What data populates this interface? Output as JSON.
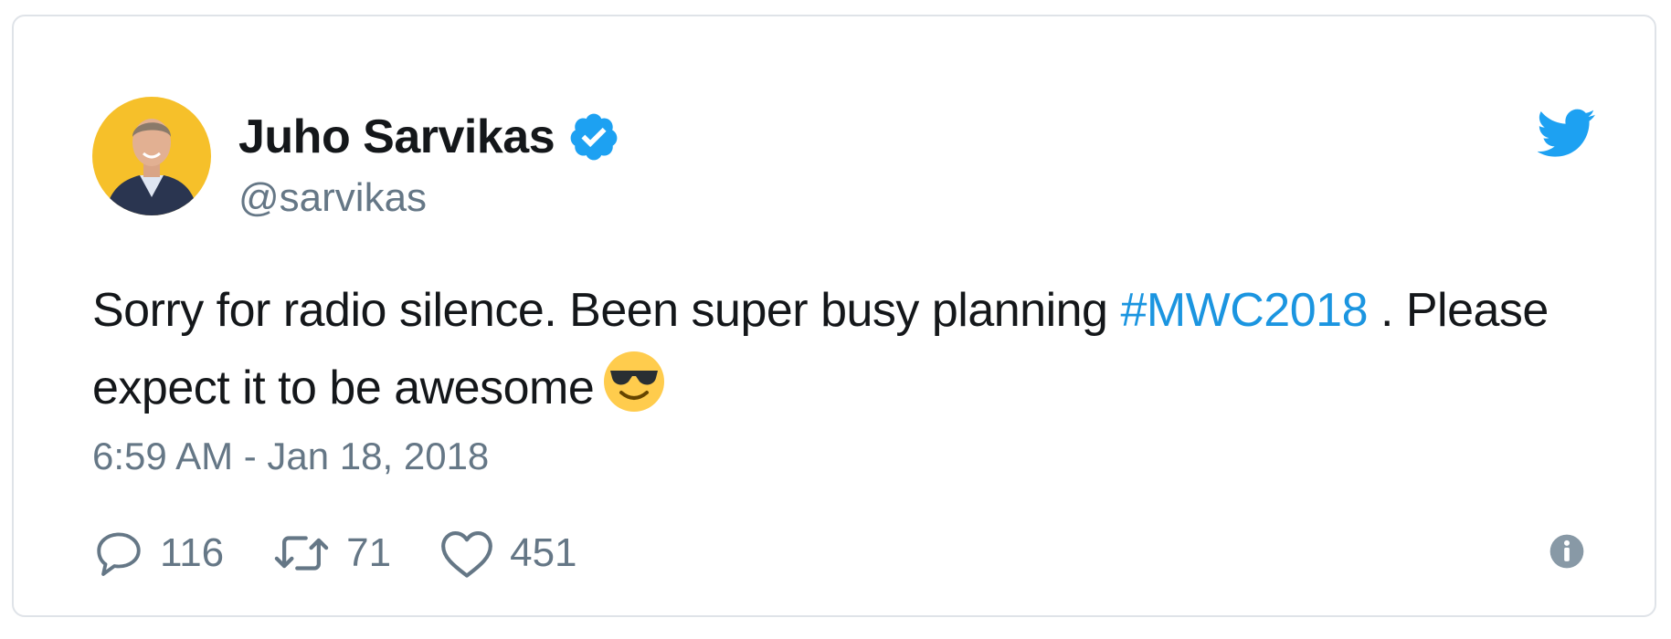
{
  "author": {
    "display_name": "Juho Sarvikas",
    "handle": "@sarvikas",
    "verified": true,
    "avatar_icon": "profile-photo"
  },
  "tweet": {
    "text_before": "Sorry for radio silence. Been super busy planning ",
    "hashtag": "#MWC2018",
    "text_after": " . Please expect it to be awesome",
    "emoji": "smiling-face-with-sunglasses",
    "timestamp": "6:59 AM - Jan 18, 2018"
  },
  "actions": {
    "reply_count": "116",
    "retweet_count": "71",
    "like_count": "451"
  },
  "colors": {
    "link": "#1b95e0",
    "text": "#14171a",
    "muted": "#657786",
    "verified": "#1da1f2",
    "bird": "#1da1f2"
  },
  "icons": [
    "twitter-bird-icon",
    "verified-badge-icon",
    "reply-icon",
    "retweet-icon",
    "like-icon",
    "info-icon"
  ]
}
